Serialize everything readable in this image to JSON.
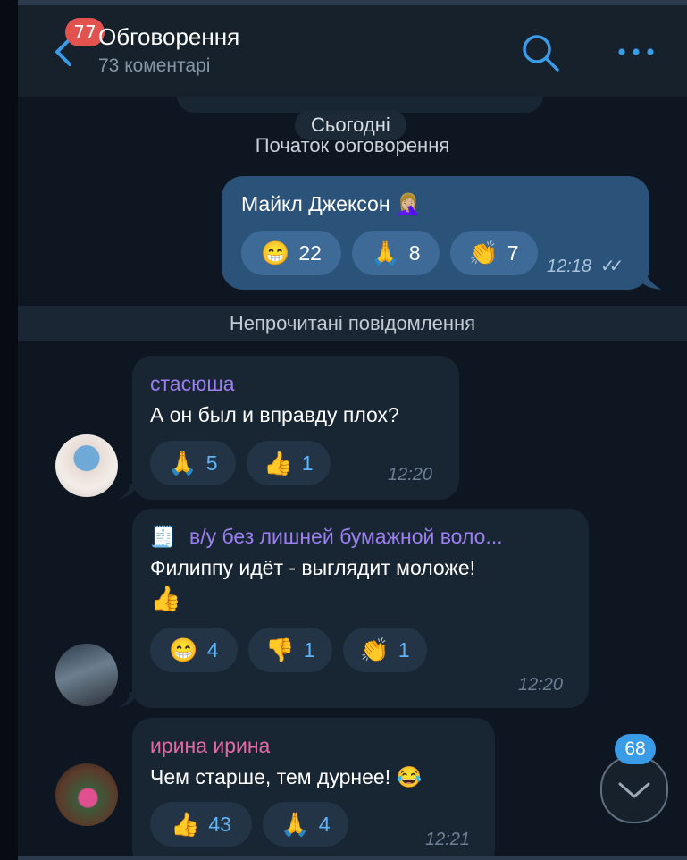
{
  "header": {
    "unread_count": "77",
    "title": "Обговорення",
    "subtitle": "73 коментарі"
  },
  "chat": {
    "date_separator": "Сьогодні",
    "discussion_start": "Початок обговорення",
    "unread_separator": "Непрочитані повідомлення",
    "messages": [
      {
        "outgoing": true,
        "text": "Майкл Джексон 🤦🏼‍♀️",
        "reactions": [
          {
            "emoji": "😁",
            "count": "22"
          },
          {
            "emoji": "🙏",
            "count": "8"
          },
          {
            "emoji": "👏",
            "count": "7"
          }
        ],
        "time": "12:18",
        "read_mark": "✓✓"
      },
      {
        "sender": "стасюша",
        "sender_color": "#9c7ff0",
        "text": "А он был и вправду плох?",
        "reactions": [
          {
            "emoji": "🙏",
            "count": "5"
          },
          {
            "emoji": "👍",
            "count": "1"
          }
        ],
        "time": "12:20"
      },
      {
        "sender_icon": "🧾",
        "sender": "в/у без лишней бумажной воло...",
        "sender_color": "#9c7ff0",
        "text": "Филиппу идёт - выглядит моложе!",
        "text_line2": "👍",
        "reactions": [
          {
            "emoji": "😁",
            "count": "4"
          },
          {
            "emoji": "👎",
            "count": "1"
          },
          {
            "emoji": "👏",
            "count": "1"
          }
        ],
        "time": "12:20"
      },
      {
        "sender": "ирина ирина",
        "sender_color": "#e36aa5",
        "text": "Чем старше, тем дурнее! 😂",
        "reactions": [
          {
            "emoji": "👍",
            "count": "43"
          },
          {
            "emoji": "🙏",
            "count": "4"
          }
        ],
        "time": "12:21"
      }
    ]
  },
  "scroll_down": {
    "badge": "68"
  },
  "colors": {
    "accent": "#3a9be7",
    "background": "#0e1621",
    "header": "#17212b",
    "outgoing_bubble": "#2b5278",
    "incoming_bubble": "#182533"
  },
  "icons": {
    "back": "chevron-left-icon",
    "search": "search-icon",
    "more": "more-horizontal-icon",
    "scroll": "chevron-down-icon"
  }
}
